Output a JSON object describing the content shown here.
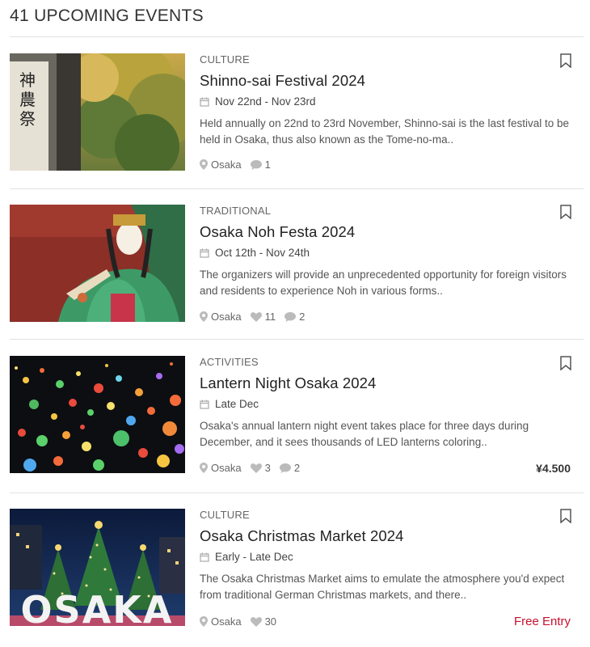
{
  "header": {
    "title": "41 UPCOMING EVENTS"
  },
  "colors": {
    "accent_free": "#c8102e",
    "divider": "#e2e2e2",
    "icon": "#aaaaaa"
  },
  "events": [
    {
      "category": "CULTURE",
      "title": "Shinno-sai Festival 2024",
      "dates": "Nov 22nd - Nov 23rd",
      "description": "Held annually on 22nd to 23rd November, Shinno-sai is the last festival to be held in Osaka, thus also known as the Tome-no-ma..",
      "location": "Osaka",
      "comments": "1",
      "image_text": "神農祭"
    },
    {
      "category": "TRADITIONAL",
      "title": "Osaka Noh Festa 2024",
      "dates": "Oct 12th - Nov 24th",
      "description": "The organizers will provide an unprecedented opportunity for foreign visitors and residents to experience Noh in various forms..",
      "location": "Osaka",
      "likes": "11",
      "comments": "2"
    },
    {
      "category": "ACTIVITIES",
      "title": "Lantern Night Osaka 2024",
      "dates": "Late Dec",
      "description": "Osaka's annual lantern night event takes place for three days during December, and it sees thousands of LED lanterns coloring..",
      "location": "Osaka",
      "likes": "3",
      "comments": "2",
      "price": "¥4.500"
    },
    {
      "category": "CULTURE",
      "title": "Osaka Christmas Market 2024",
      "dates": "Early - Late Dec",
      "description": "The Osaka Christmas Market aims to emulate the atmosphere you'd expect from traditional German Christmas markets, and there..",
      "location": "Osaka",
      "likes": "30",
      "price": "Free Entry",
      "image_text": "OSAKA"
    }
  ]
}
